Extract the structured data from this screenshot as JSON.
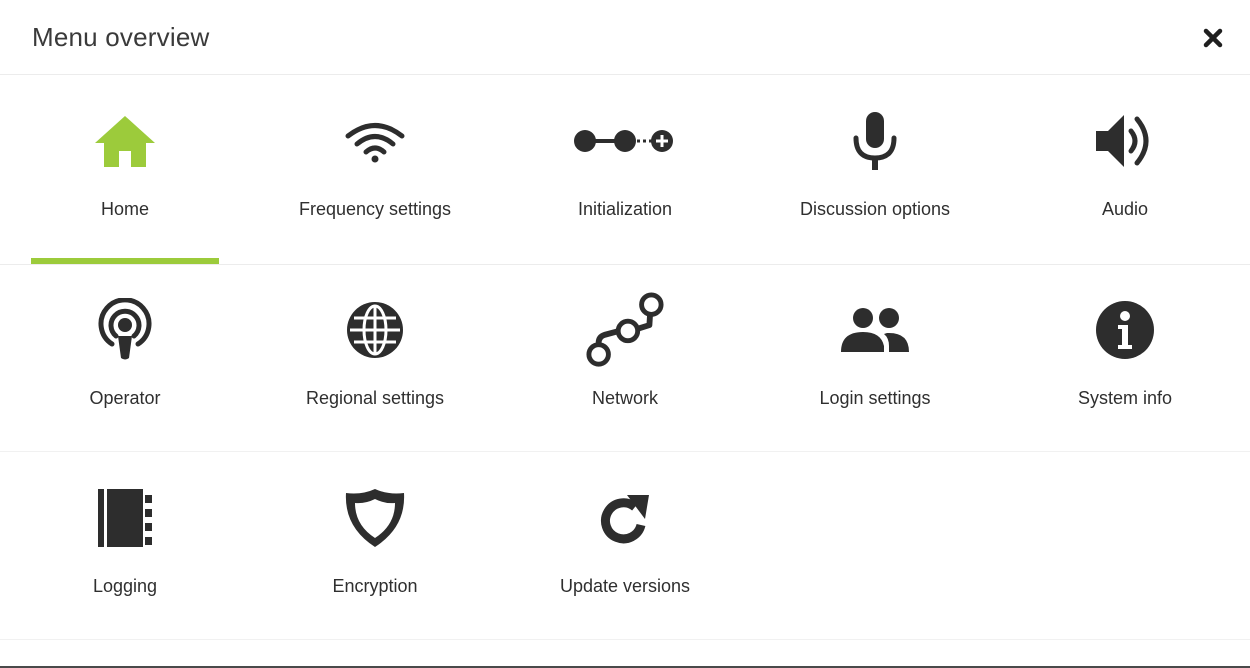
{
  "dialog": {
    "title": "Menu overview",
    "close_icon": "close-icon"
  },
  "colors": {
    "accent": "#9ccb3b",
    "icon": "#2d2d2d"
  },
  "tiles": [
    {
      "label": "Home",
      "icon": "home-icon",
      "active": true
    },
    {
      "label": "Frequency settings",
      "icon": "wifi-icon"
    },
    {
      "label": "Initialization",
      "icon": "initialization-icon"
    },
    {
      "label": "Discussion options",
      "icon": "microphone-icon"
    },
    {
      "label": "Audio",
      "icon": "speaker-icon"
    },
    {
      "label": "Operator",
      "icon": "operator-icon"
    },
    {
      "label": "Regional settings",
      "icon": "globe-icon"
    },
    {
      "label": "Network",
      "icon": "network-icon"
    },
    {
      "label": "Login settings",
      "icon": "users-icon"
    },
    {
      "label": "System info",
      "icon": "info-icon"
    },
    {
      "label": "Logging",
      "icon": "notebook-icon"
    },
    {
      "label": "Encryption",
      "icon": "shield-icon"
    },
    {
      "label": "Update versions",
      "icon": "refresh-icon"
    }
  ]
}
